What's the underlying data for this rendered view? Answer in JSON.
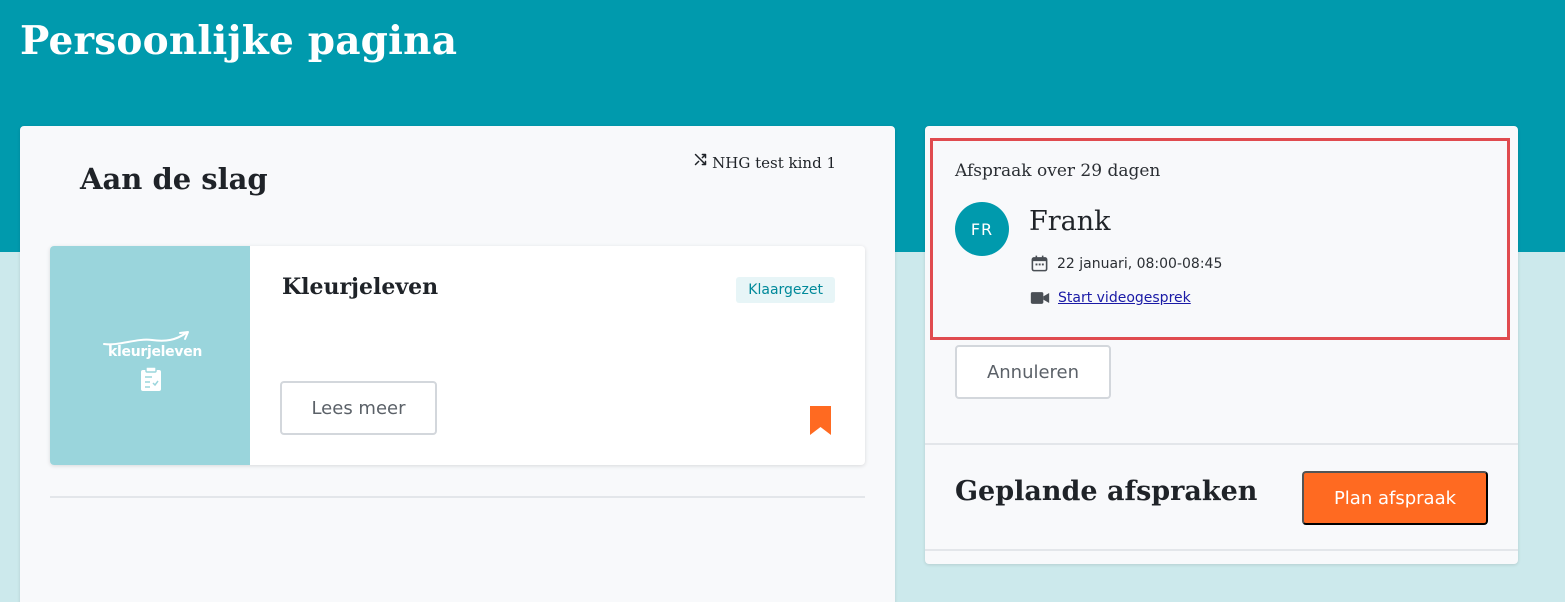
{
  "page": {
    "title": "Persoonlijke pagina"
  },
  "start": {
    "title": "Aan de slag",
    "profile_switch": {
      "label": "NHG test kind 1",
      "icon": "shuffle-icon"
    },
    "program": {
      "title": "Kleurjeleven",
      "logo_text": "kleurjeleven",
      "status": "Klaargezet",
      "read_more_label": "Lees meer",
      "bookmark_icon": "bookmark-icon"
    }
  },
  "appointment": {
    "countdown": "Afspraak over 29 dagen",
    "initials": "FR",
    "name": "Frank",
    "datetime": "22 januari, 08:00-08:45",
    "video_link": "Start videogesprek",
    "cancel_label": "Annuleren"
  },
  "planned": {
    "title": "Geplande afspraken",
    "plan_label": "Plan afspraak"
  },
  "colors": {
    "brand": "#009aad",
    "brand_light": "#cce9ec",
    "accent": "#ff6a21",
    "highlight": "#e04b4f"
  }
}
